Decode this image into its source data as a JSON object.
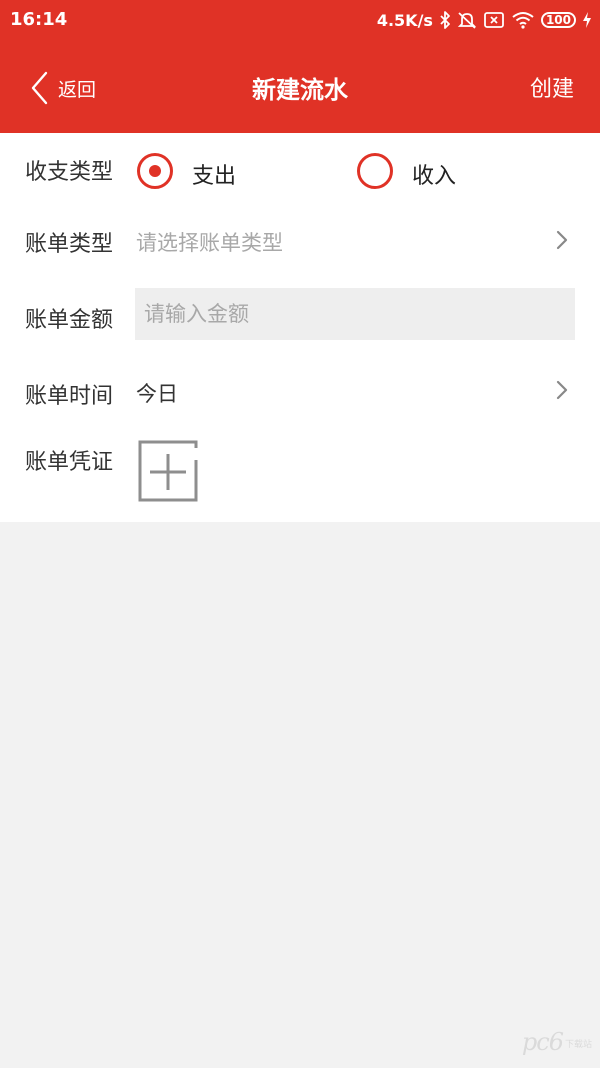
{
  "status_bar": {
    "time": "16:14",
    "net_speed": "4.5K/s",
    "battery": "100",
    "icons": [
      "bluetooth-icon",
      "mute-bell-icon",
      "sim-x-icon",
      "wifi-icon",
      "battery-icon",
      "charging-icon"
    ]
  },
  "nav": {
    "back_label": "返回",
    "title": "新建流水",
    "create_label": "创建",
    "background_color": "#e03226"
  },
  "form": {
    "type": {
      "label": "收支类型",
      "options": [
        {
          "label": "支出",
          "selected": true
        },
        {
          "label": "收入",
          "selected": false
        }
      ]
    },
    "bill_type": {
      "label": "账单类型",
      "placeholder": "请选择账单类型"
    },
    "amount": {
      "label": "账单金额",
      "value": "",
      "placeholder": "请输入金额"
    },
    "time": {
      "label": "账单时间",
      "value": "今日"
    },
    "voucher": {
      "label": "账单凭证"
    }
  },
  "watermark": {
    "main": "pc6",
    "sub": "下载站"
  }
}
